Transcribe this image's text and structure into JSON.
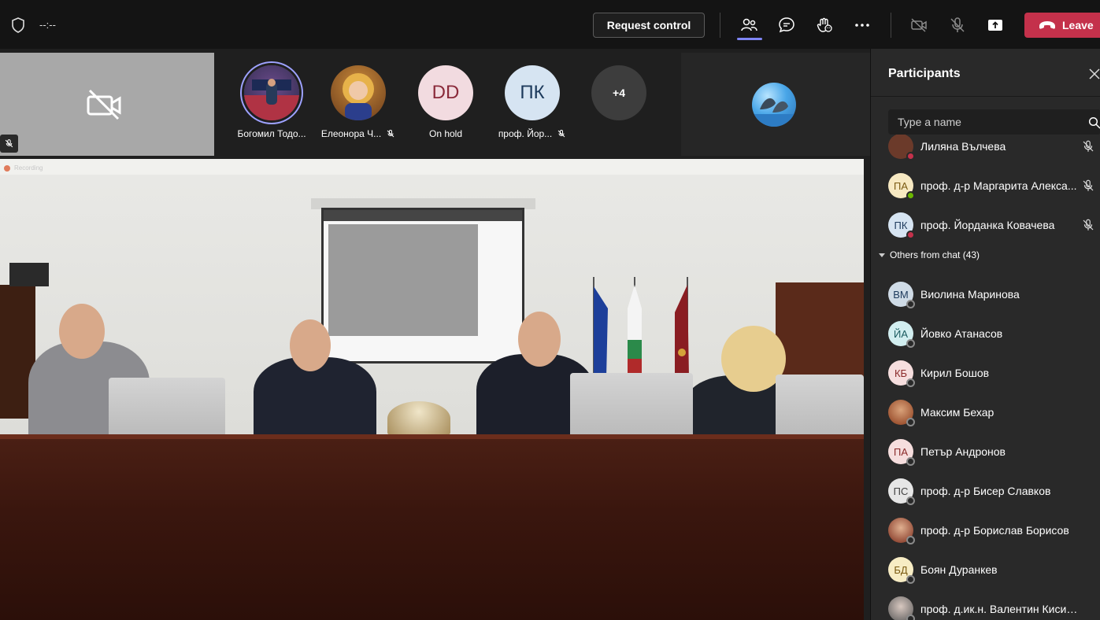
{
  "topbar": {
    "timer": "--:--",
    "request_control_label": "Request control",
    "leave_label": "Leave"
  },
  "strip": {
    "participants": [
      {
        "name": "Богомил Тодо...",
        "initials": "",
        "muted": false
      },
      {
        "name": "Елеонора Ч...",
        "initials": "",
        "muted": true
      },
      {
        "name": "On hold",
        "initials": "DD",
        "muted": false
      },
      {
        "name": "проф. Йор...",
        "initials": "ПК",
        "muted": true
      }
    ],
    "more_label": "+4"
  },
  "stage": {
    "recording_label": "Recording"
  },
  "panel": {
    "title": "Participants",
    "search_placeholder": "Type a name",
    "in_meeting": [
      {
        "name": "Лиляна Вълчева",
        "initials": "",
        "status": "busy"
      },
      {
        "name": "проф. д-р Маргарита Алекса...",
        "initials": "ПА",
        "status": "available"
      },
      {
        "name": "проф. Йорданка Ковачева",
        "initials": "ПК",
        "status": "busy"
      }
    ],
    "section_label": "Others from chat (43)",
    "others": [
      {
        "name": "Виолина Маринова",
        "initials": "ВМ"
      },
      {
        "name": "Йовко Атанасов",
        "initials": "ЙА"
      },
      {
        "name": "Кирил Бошов",
        "initials": "КБ"
      },
      {
        "name": "Максим Бехар",
        "initials": ""
      },
      {
        "name": "Петър Андронов",
        "initials": "ПА"
      },
      {
        "name": "проф. д-р Бисер Славков",
        "initials": "ПС"
      },
      {
        "name": "проф. д-р Борислав Борисов",
        "initials": ""
      },
      {
        "name": "Боян Дуранкев",
        "initials": "БД"
      },
      {
        "name": "проф. д.ик.н. Валентин Кисимов",
        "initials": ""
      }
    ]
  },
  "colors": {
    "accent": "#7f85f5",
    "leave": "#c4314b",
    "available": "#6bb700",
    "busy": "#c4314b"
  }
}
